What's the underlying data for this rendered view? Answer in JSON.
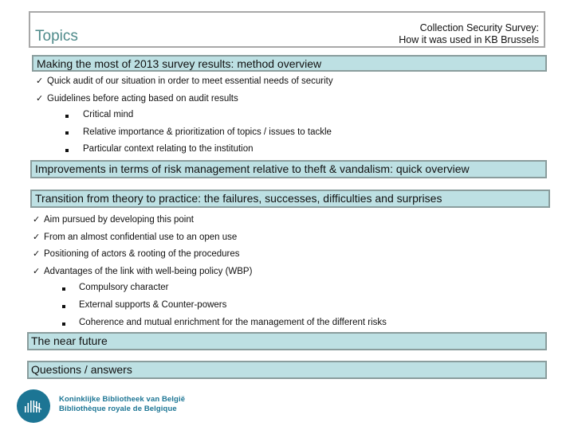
{
  "header": {
    "title": "Topics",
    "survey_line1": "Collection Security Survey:",
    "survey_line2": "How it was used in KB Brussels"
  },
  "sections": [
    {
      "label": "Making the most of 2013 survey results: method overview",
      "checks": [
        {
          "label": "Quick audit of our situation in order to meet essential needs of security",
          "subitems": []
        },
        {
          "label": "Guidelines before acting based on audit results",
          "subitems": [
            "Critical mind",
            "Relative importance & prioritization of topics / issues to tackle",
            "Particular context relating to the institution"
          ]
        }
      ]
    },
    {
      "label": "Improvements in terms of risk management relative to theft & vandalism: quick overview",
      "checks": []
    },
    {
      "label": "Transition from theory to practice: the failures, successes, difficulties and surprises",
      "checks": [
        {
          "label": "Aim pursued by developing this point",
          "subitems": []
        },
        {
          "label": "From an almost confidential use to an open use",
          "subitems": []
        },
        {
          "label": "Positioning of actors & rooting of the procedures",
          "subitems": []
        },
        {
          "label": "Advantages of the link with well-being policy (WBP)",
          "subitems": [
            "Compulsory character",
            "External supports & Counter-powers",
            "Coherence and mutual enrichment for the management of the different risks"
          ]
        }
      ]
    },
    {
      "label": "The near future",
      "checks": []
    },
    {
      "label": "Questions / answers",
      "checks": []
    }
  ],
  "icons": {
    "check": "✓"
  },
  "logo": {
    "line1": "Koninklijke Bibliotheek van België",
    "line2": "Bibliothèque royale de Belgique",
    "color": "#1c7594"
  },
  "colors": {
    "section_bg": "#bde0e3",
    "section_border": "#8a9d9d",
    "title_color": "#4e8a8a"
  }
}
